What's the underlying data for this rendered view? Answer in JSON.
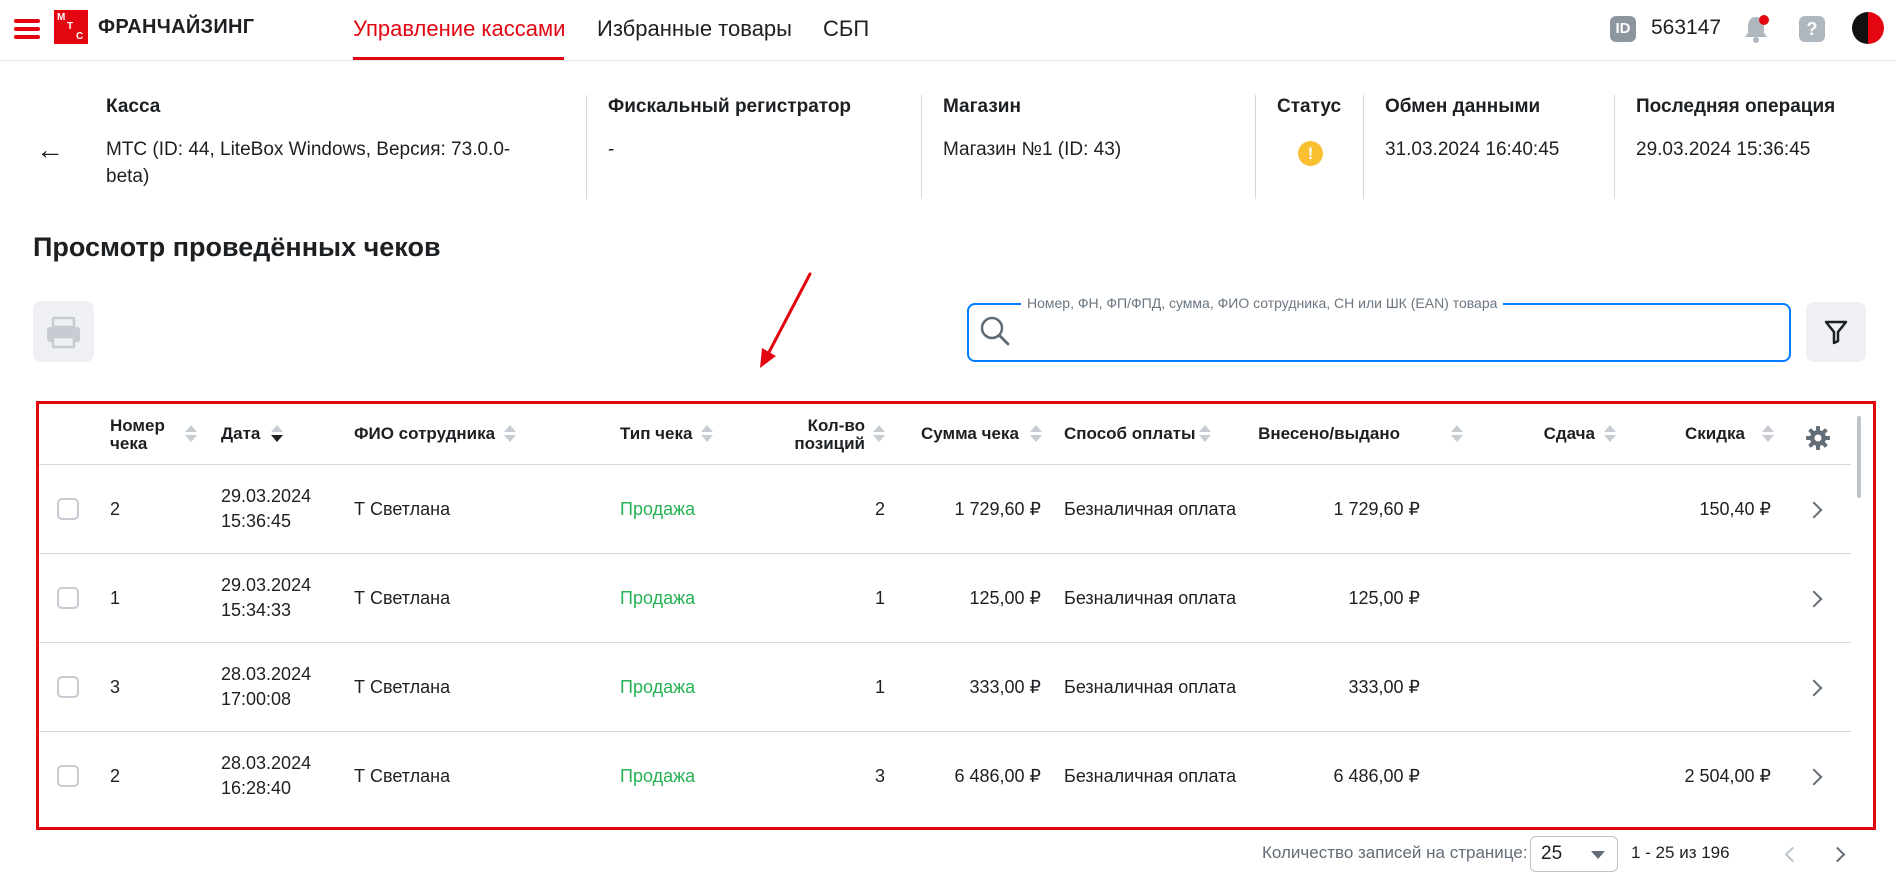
{
  "header": {
    "brand": "ФРАНЧАЙЗИНГ",
    "logo_letters": [
      "М",
      "Т",
      "С"
    ],
    "nav": [
      {
        "label": "Управление кассами",
        "active": true
      },
      {
        "label": "Избранные товары",
        "active": false
      },
      {
        "label": "СБП",
        "active": false
      }
    ],
    "id_badge": "ID",
    "account_id": "563147",
    "help": "?",
    "accent": "#e30611"
  },
  "info": {
    "kassa": {
      "label": "Касса",
      "value": "МТС (ID: 44, LiteBox Windows, Версия: 73.0.0-beta)"
    },
    "fiscal": {
      "label": "Фискальный регистратор",
      "value": "-"
    },
    "shop": {
      "label": "Магазин",
      "value": "Магазин №1 (ID: 43)"
    },
    "status": {
      "label": "Статус",
      "icon": "warning-icon",
      "icon_glyph": "!"
    },
    "exchange": {
      "label": "Обмен данными",
      "value": "31.03.2024 16:40:45"
    },
    "last_op": {
      "label": "Последняя операция",
      "value": "29.03.2024 15:36:45"
    }
  },
  "page_title": "Просмотр проведённых чеков",
  "search": {
    "label": "Номер, ФН, ФП/ФПД, сумма, ФИО сотрудника, СН или ШК (EAN) товара",
    "value": ""
  },
  "table": {
    "columns": {
      "number": "Номер чека",
      "date": "Дата",
      "employee": "ФИО сотрудника",
      "type": "Тип чека",
      "qty": "Кол-во позиций",
      "sum": "Сумма чека",
      "payment": "Способ оплаты",
      "paid": "Внесено/выдано",
      "change": "Сдача",
      "discount": "Скидка"
    },
    "rows": [
      {
        "number": "2",
        "date": "29.03.2024",
        "time": "15:36:45",
        "employee": "Т Светлана",
        "type": "Продажа",
        "qty": "2",
        "sum": "1 729,60 ₽",
        "payment": "Безналичная оплата",
        "paid": "1 729,60 ₽",
        "change": "",
        "discount": "150,40 ₽"
      },
      {
        "number": "1",
        "date": "29.03.2024",
        "time": "15:34:33",
        "employee": "Т Светлана",
        "type": "Продажа",
        "qty": "1",
        "sum": "125,00 ₽",
        "payment": "Безналичная оплата",
        "paid": "125,00 ₽",
        "change": "",
        "discount": ""
      },
      {
        "number": "3",
        "date": "28.03.2024",
        "time": "17:00:08",
        "employee": "Т Светлана",
        "type": "Продажа",
        "qty": "1",
        "sum": "333,00 ₽",
        "payment": "Безналичная оплата",
        "paid": "333,00 ₽",
        "change": "",
        "discount": ""
      },
      {
        "number": "2",
        "date": "28.03.2024",
        "time": "16:28:40",
        "employee": "Т Светлана",
        "type": "Продажа",
        "qty": "3",
        "sum": "6 486,00 ₽",
        "payment": "Безналичная оплата",
        "paid": "6 486,00 ₽",
        "change": "",
        "discount": "2 504,00 ₽"
      }
    ]
  },
  "pagination": {
    "label": "Количество записей на странице:",
    "page_size": "25",
    "range": "1 - 25 из 196"
  }
}
